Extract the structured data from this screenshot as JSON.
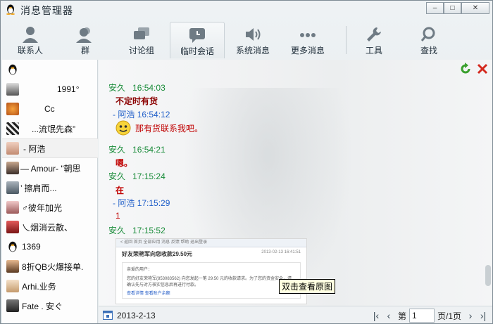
{
  "window": {
    "title": "消息管理器",
    "minimize": "–",
    "maximize": "□",
    "close": "✕"
  },
  "toolbar": {
    "items": [
      {
        "label": "联系人",
        "icon": "person-icon"
      },
      {
        "label": "群",
        "icon": "group-icon"
      },
      {
        "label": "讨论组",
        "icon": "discussion-icon"
      },
      {
        "label": "临时会话",
        "icon": "temp-chat-icon"
      },
      {
        "label": "系统消息",
        "icon": "speaker-icon"
      },
      {
        "label": "更多消息",
        "icon": "more-icon"
      },
      {
        "label": "工具",
        "icon": "wrench-icon"
      },
      {
        "label": "查找",
        "icon": "search-icon"
      }
    ],
    "active": "临时会话"
  },
  "contacts": [
    {
      "name": ""
    },
    {
      "name": "1991°"
    },
    {
      "name": "Cc"
    },
    {
      "name": "...流氓先森”"
    },
    {
      "name": "- 阿浩"
    },
    {
      "name": "— Amour- \"朝思"
    },
    {
      "name": "’             擦肩而..."
    },
    {
      "name": "♂彼年加光"
    },
    {
      "name": "乀烟消云散、"
    },
    {
      "name": "1369"
    },
    {
      "name": "8折QB火爆接单."
    },
    {
      "name": "Arhi.业务"
    },
    {
      "name": "Fate .      安ぐ"
    }
  ],
  "messages": {
    "m1_sender": "安久",
    "m1_time": "16:54:03",
    "m1_text": "不定时有货",
    "m2_sender": "- 阿浩",
    "m2_time": "16:54:12",
    "m2_text": "那有货联系我吧。",
    "m3_sender": "安久",
    "m3_time": "16:54:21",
    "m3_text": "嗯。",
    "m4_sender": "安久",
    "m4_time": "17:15:24",
    "m4_text": "在",
    "m5_sender": "- 阿浩",
    "m5_time": "17:15:29",
    "m5_text": "1",
    "m6_sender": "安久",
    "m6_time": "17:15:52"
  },
  "thumbnail": {
    "bar": "< 返回   首页   全部应用   消息      反馈   帮助   退出登录",
    "title": "好友荣艳军向您收款29.50元",
    "date": "2013-02-13 16:41:51",
    "greeting": "亲爱的用户：",
    "body": "您的好友荣艳军(853083562) 向您发起一笔 29.50 元的收款请求。为了您的资金安全，请确认先与对方核实信息后再进行付款。",
    "links": "查看详情    查看账户余额"
  },
  "tooltip": "双击查看原图",
  "footer": {
    "date": "2013-2-13",
    "page_prefix": "第",
    "page_value": "1",
    "page_suffix": "页/1页"
  },
  "colors": {
    "sender_a": "#1a8c3a",
    "sender_b": "#1f5ec9",
    "msg_red": "#c00000"
  }
}
